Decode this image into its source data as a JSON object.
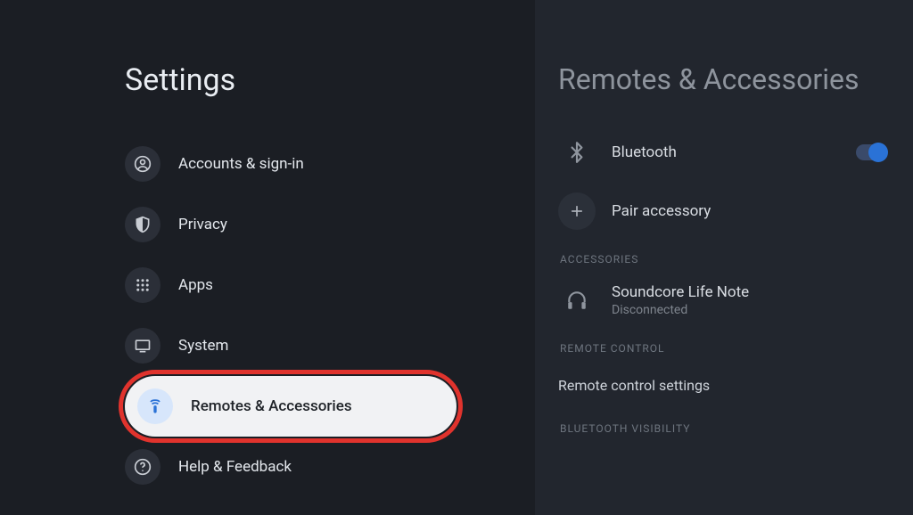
{
  "page_title": "Settings",
  "sidebar": {
    "items": [
      {
        "label": "Accounts & sign-in"
      },
      {
        "label": "Privacy"
      },
      {
        "label": "Apps"
      },
      {
        "label": "System"
      },
      {
        "label": "Remotes & Accessories"
      },
      {
        "label": "Help & Feedback"
      }
    ]
  },
  "detail": {
    "title": "Remotes & Accessories",
    "bluetooth_label": "Bluetooth",
    "pair_label": "Pair accessory",
    "accessories_caption": "ACCESSORIES",
    "accessory_name": "Soundcore Life Note",
    "accessory_status": "Disconnected",
    "remote_control_caption": "REMOTE CONTROL",
    "remote_settings_label": "Remote control settings",
    "bt_visibility_caption": "BLUETOOTH VISIBILITY"
  }
}
